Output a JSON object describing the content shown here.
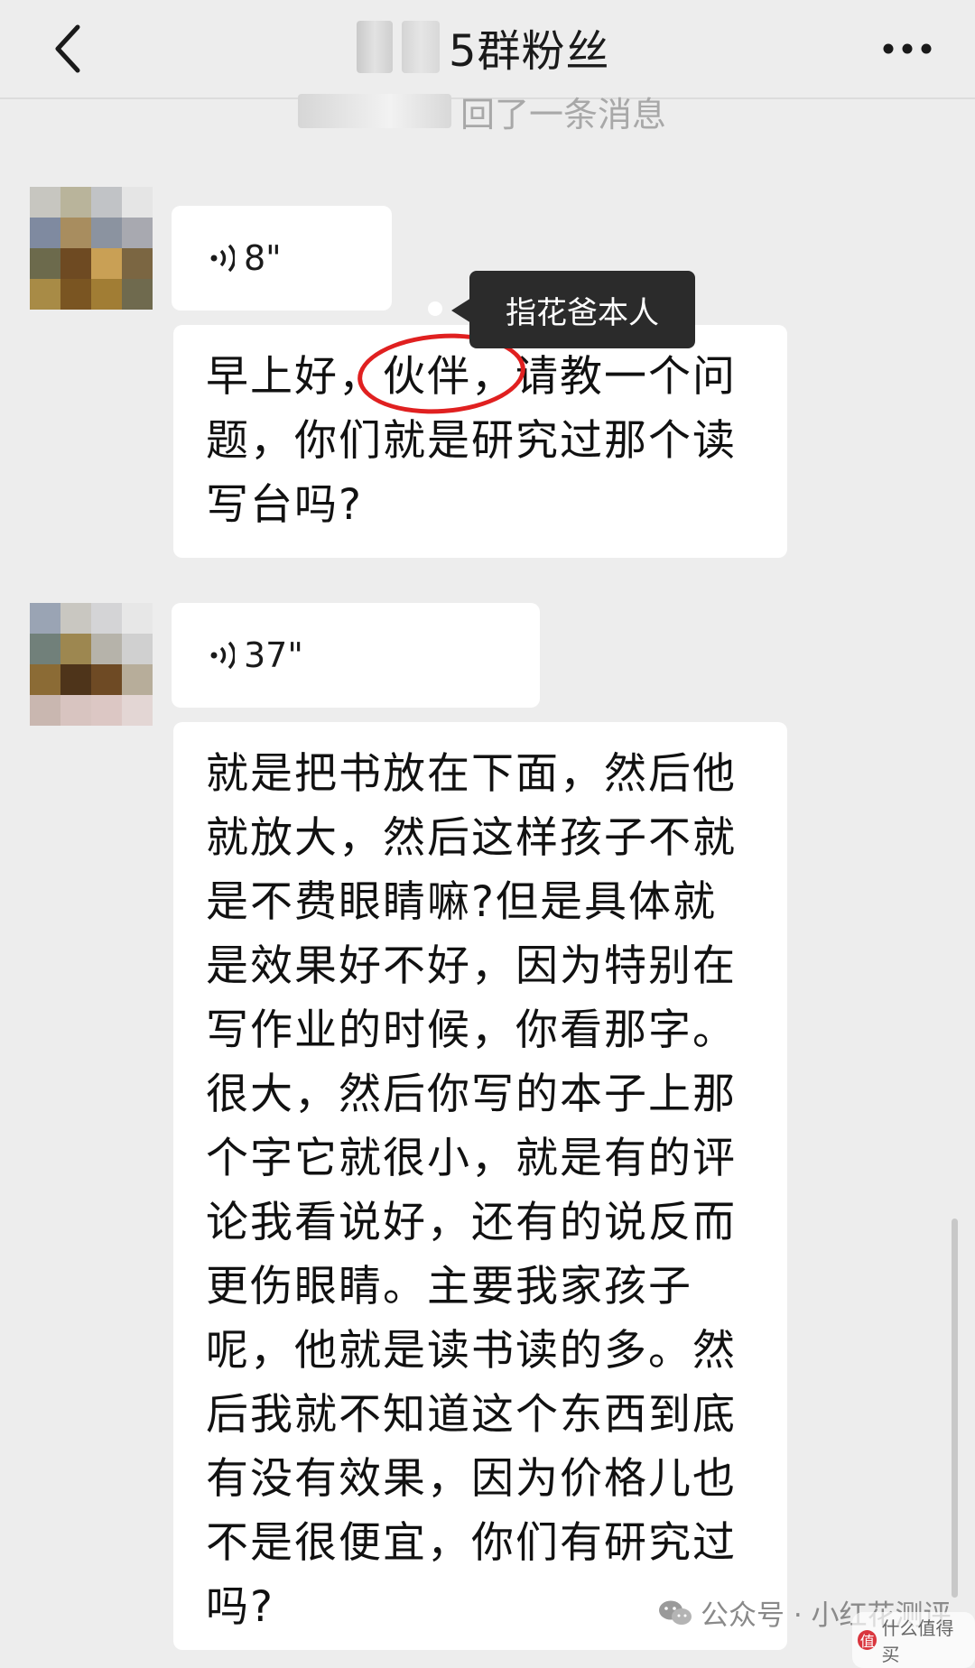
{
  "header": {
    "title": "5群粉丝"
  },
  "system_message": "回了一条消息",
  "messages": [
    {
      "type": "voice",
      "duration": "8\""
    },
    {
      "type": "text",
      "text": "早上好，伙伴，请教一个问题，你们就是研究过那个读写台吗?"
    },
    {
      "type": "voice",
      "duration": "37\""
    },
    {
      "type": "text",
      "text": "就是把书放在下面，然后他就放大，然后这样孩子不就是不费眼睛嘛?但是具体就是效果好不好，因为特别在写作业的时候，你看那字。很大，然后你写的本子上那个字它就很小，就是有的评论我看说好，还有的说反而更伤眼睛。主要我家孩子呢，他就是读书读的多。然后我就不知道这个东西到底有没有效果，因为价格儿也不是很便宜，你们有研究过吗?"
    }
  ],
  "annotation": {
    "tooltip": "指花爸本人",
    "circle_color": "#e02020"
  },
  "watermark": {
    "text": "公众号 · 小红花测评",
    "site": "什么值得买"
  },
  "colors": {
    "background": "#ededed",
    "bubble": "#ffffff",
    "tooltip_bg": "#2b2b2b"
  },
  "icons": {
    "back": "chevron-left-icon",
    "more": "more-dots-icon",
    "voice": "voice-wave-icon"
  }
}
